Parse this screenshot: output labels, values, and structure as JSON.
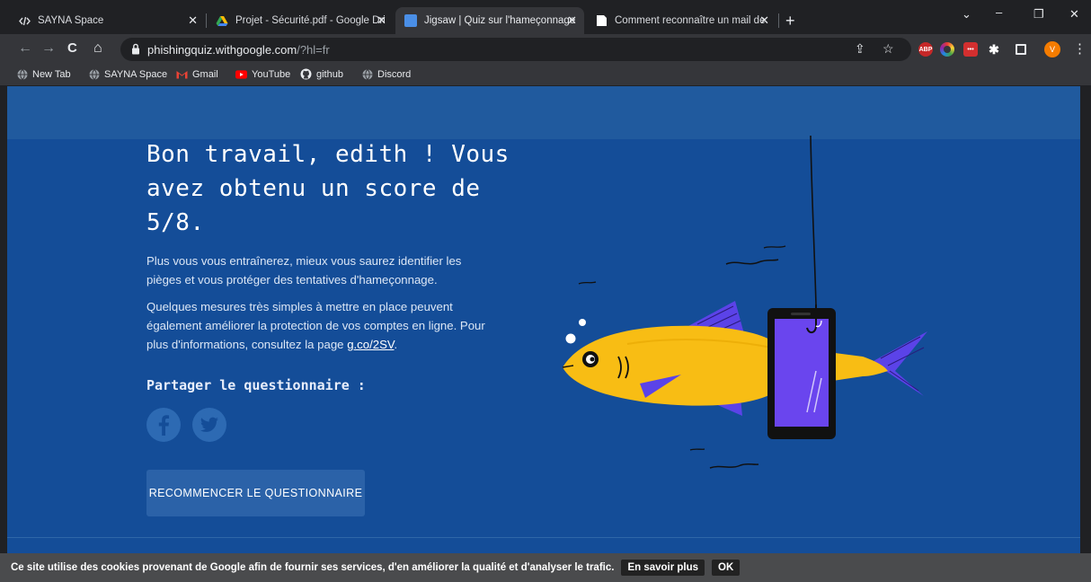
{
  "browser": {
    "tabs": [
      {
        "title": "SAYNA Space",
        "icon": "code-icon",
        "active": false
      },
      {
        "title": "Projet - Sécurité.pdf - Google Dri",
        "icon": "google-drive-icon",
        "active": false
      },
      {
        "title": "Jigsaw | Quiz sur l'hameçonnage",
        "icon": "jigsaw-icon",
        "active": true
      },
      {
        "title": "Comment reconnaître un mail de",
        "icon": "page-icon",
        "active": false
      }
    ],
    "url_host": "phishingquiz.withgoogle.com",
    "url_path": "/?hl=fr",
    "profile_initial": "V",
    "extension_abp": "ABP",
    "bookmarks": [
      {
        "label": "New Tab",
        "icon": "globe-icon"
      },
      {
        "label": "SAYNA Space",
        "icon": "globe-icon"
      },
      {
        "label": "Gmail",
        "icon": "gmail-icon"
      },
      {
        "label": "YouTube",
        "icon": "youtube-icon"
      },
      {
        "label": "github",
        "icon": "github-icon"
      },
      {
        "label": "Discord",
        "icon": "globe-icon"
      }
    ]
  },
  "result": {
    "headline": "Bon travail, edith ! Vous avez obtenu un score de 5/8.",
    "para1": "Plus vous vous entraînerez, mieux vous saurez identifier les pièges et vous protéger des tentatives d'hameçonnage.",
    "para2": "Quelques mesures très simples à mettre en place peuvent également améliorer la protection de vos comptes en ligne. Pour plus d'informations, consultez la page",
    "para2_link": "g.co/2SV",
    "para2_end": ".",
    "share_title": "Partager le questionnaire :",
    "restart_label": "RECOMMENCER LE QUESTIONNAIRE"
  },
  "cookie": {
    "text": "Ce site utilise des cookies provenant de Google afin de fournir ses services, d'en améliorer la qualité et d'analyser le trafic.",
    "learn_more": "En savoir plus",
    "ok": "OK"
  },
  "colors": {
    "page_bg": "#144d98",
    "fish": "#f8bd14",
    "fin": "#5b43e8",
    "phone_screen": "#6a45ee"
  }
}
